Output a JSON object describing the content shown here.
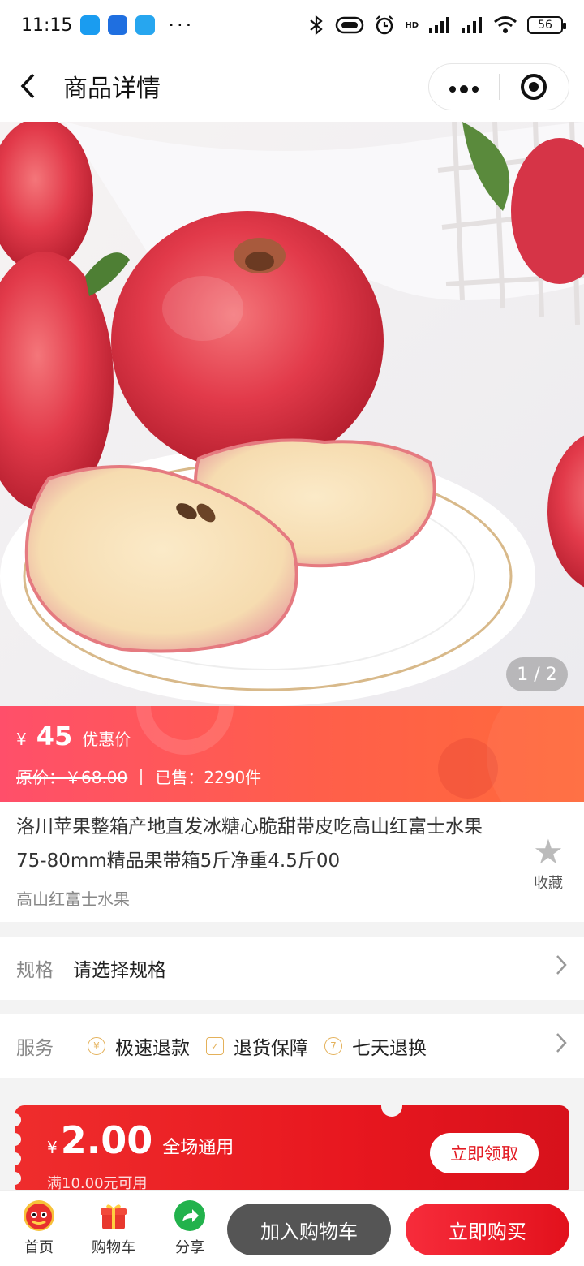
{
  "status_bar": {
    "time": "11:15",
    "network": "HD",
    "battery": "56"
  },
  "navbar": {
    "back_icon": "chevron-left-icon",
    "title": "商品详情",
    "more_icon": "more-dots-icon",
    "close_icon": "target-icon"
  },
  "gallery": {
    "counter": "1 / 2"
  },
  "price": {
    "currency": "¥",
    "value": "45",
    "label": "优惠价",
    "original": "原价：￥68.00",
    "sold": "已售：2290件"
  },
  "product": {
    "title": "洛川苹果整箱产地直发冰糖心脆甜带皮吃高山红富士水果 75-80mm精品果带箱5斤净重4.5斤00",
    "subtitle": "高山红富士水果",
    "favorite_label": "收藏"
  },
  "spec": {
    "label": "规格",
    "value": "请选择规格"
  },
  "service": {
    "label": "服务",
    "items": [
      {
        "icon": "yen-icon",
        "text": "极速退款"
      },
      {
        "icon": "shield-icon",
        "text": "退货保障"
      },
      {
        "icon": "seven-days-icon",
        "text": "七天退换"
      }
    ]
  },
  "coupon": {
    "currency": "¥",
    "amount": "2.00",
    "scope": "全场通用",
    "condition": "满10.00元可用",
    "claim_label": "立即领取"
  },
  "tabbar": {
    "items": [
      {
        "label": "首页",
        "icon": "home-mascot-icon"
      },
      {
        "label": "购物车",
        "icon": "gift-cart-icon"
      },
      {
        "label": "分享",
        "icon": "share-icon"
      }
    ],
    "add_cart": "加入购物车",
    "buy_now": "立即购买"
  },
  "colors": {
    "accent_red": "#e31b23",
    "price_banner": "#ff5a55",
    "dark_button": "#555555"
  }
}
